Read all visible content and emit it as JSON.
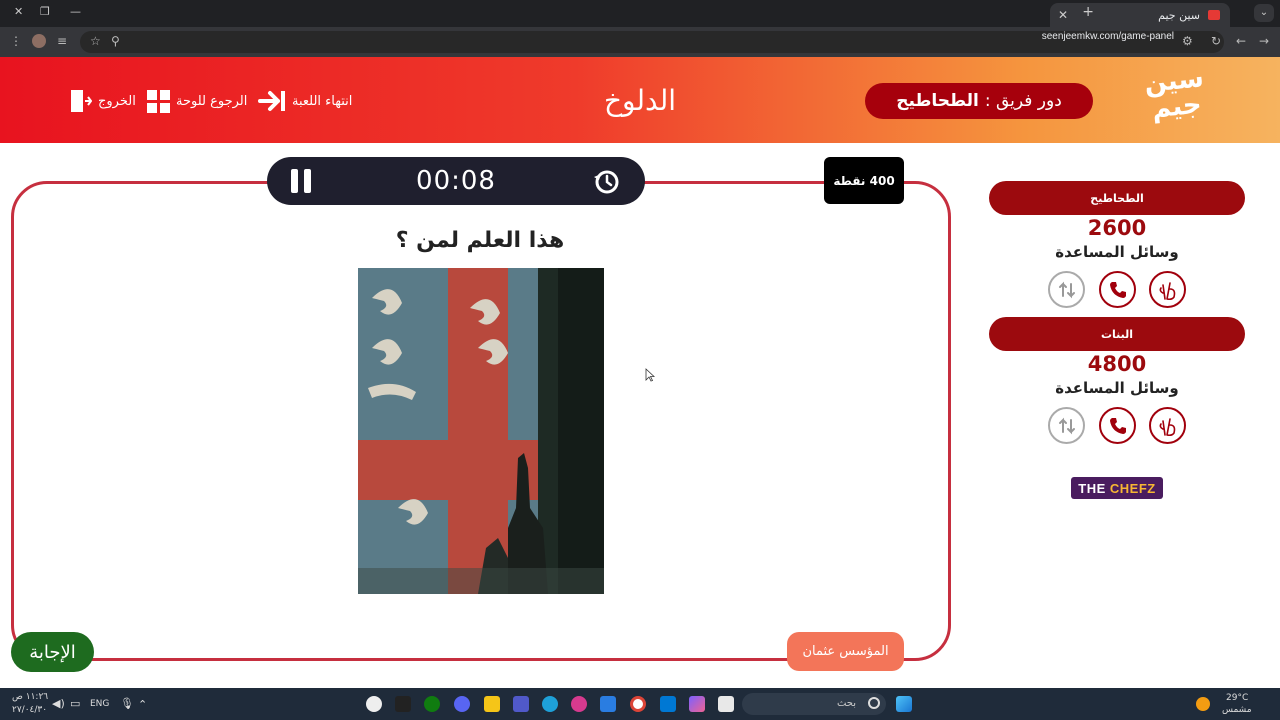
{
  "browser": {
    "tab_title": "سين جيم",
    "url": "seenjeemkw.com/game-panel"
  },
  "header": {
    "logo_text": "سين جيم",
    "turn_prefix": "دور فريق :",
    "turn_team": "الطحاطيح",
    "category": "الدلوخ",
    "end_game_label": "انتهاء اللعبة",
    "back_to_board_label": "الرجوع للوحة",
    "exit_label": "الخروج"
  },
  "question_panel": {
    "timer": "00:08",
    "points": "400 نقطة",
    "question": "هذا العلم لمن ؟",
    "host_label": "المؤسس عثمان",
    "answer_button": "الإجابة"
  },
  "teams": [
    {
      "name": "الطحاطيح",
      "score": "2600",
      "aids_label": "وسائل المساعدة"
    },
    {
      "name": "البنات",
      "score": "4800",
      "aids_label": "وسائل المساعدة"
    }
  ],
  "aids_icons": [
    "two-answers-icon",
    "phone-icon",
    "swap-turn-icon"
  ],
  "sponsor": {
    "text_a": "THE",
    "text_b": "CHEFZ"
  },
  "taskbar": {
    "search_placeholder": "بحث",
    "weather_temp": "29°C",
    "weather_desc": "مشمس",
    "language": "ENG",
    "time": "١١:٢٦ ص",
    "date": "٢٧/٠٤/٣٠"
  },
  "colors": {
    "header_start": "#e8131f",
    "header_end": "#f6b35f",
    "team_pill": "#9c0a0e",
    "board_border": "#c62f3f",
    "answer_button": "#1e6b1f",
    "host_button": "#f37559"
  }
}
